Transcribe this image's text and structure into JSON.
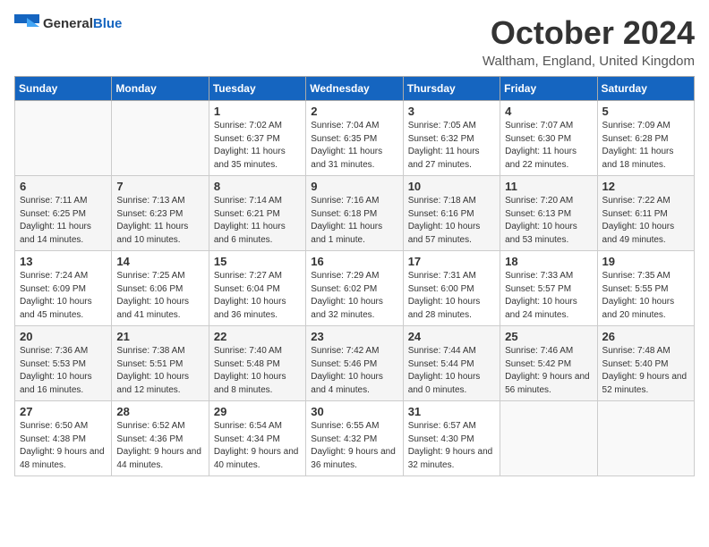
{
  "header": {
    "logo_general": "General",
    "logo_blue": "Blue",
    "month_title": "October 2024",
    "location": "Waltham, England, United Kingdom"
  },
  "weekdays": [
    "Sunday",
    "Monday",
    "Tuesday",
    "Wednesday",
    "Thursday",
    "Friday",
    "Saturday"
  ],
  "weeks": [
    [
      {
        "day": "",
        "sunrise": "",
        "sunset": "",
        "daylight": ""
      },
      {
        "day": "",
        "sunrise": "",
        "sunset": "",
        "daylight": ""
      },
      {
        "day": "1",
        "sunrise": "Sunrise: 7:02 AM",
        "sunset": "Sunset: 6:37 PM",
        "daylight": "Daylight: 11 hours and 35 minutes."
      },
      {
        "day": "2",
        "sunrise": "Sunrise: 7:04 AM",
        "sunset": "Sunset: 6:35 PM",
        "daylight": "Daylight: 11 hours and 31 minutes."
      },
      {
        "day": "3",
        "sunrise": "Sunrise: 7:05 AM",
        "sunset": "Sunset: 6:32 PM",
        "daylight": "Daylight: 11 hours and 27 minutes."
      },
      {
        "day": "4",
        "sunrise": "Sunrise: 7:07 AM",
        "sunset": "Sunset: 6:30 PM",
        "daylight": "Daylight: 11 hours and 22 minutes."
      },
      {
        "day": "5",
        "sunrise": "Sunrise: 7:09 AM",
        "sunset": "Sunset: 6:28 PM",
        "daylight": "Daylight: 11 hours and 18 minutes."
      }
    ],
    [
      {
        "day": "6",
        "sunrise": "Sunrise: 7:11 AM",
        "sunset": "Sunset: 6:25 PM",
        "daylight": "Daylight: 11 hours and 14 minutes."
      },
      {
        "day": "7",
        "sunrise": "Sunrise: 7:13 AM",
        "sunset": "Sunset: 6:23 PM",
        "daylight": "Daylight: 11 hours and 10 minutes."
      },
      {
        "day": "8",
        "sunrise": "Sunrise: 7:14 AM",
        "sunset": "Sunset: 6:21 PM",
        "daylight": "Daylight: 11 hours and 6 minutes."
      },
      {
        "day": "9",
        "sunrise": "Sunrise: 7:16 AM",
        "sunset": "Sunset: 6:18 PM",
        "daylight": "Daylight: 11 hours and 1 minute."
      },
      {
        "day": "10",
        "sunrise": "Sunrise: 7:18 AM",
        "sunset": "Sunset: 6:16 PM",
        "daylight": "Daylight: 10 hours and 57 minutes."
      },
      {
        "day": "11",
        "sunrise": "Sunrise: 7:20 AM",
        "sunset": "Sunset: 6:13 PM",
        "daylight": "Daylight: 10 hours and 53 minutes."
      },
      {
        "day": "12",
        "sunrise": "Sunrise: 7:22 AM",
        "sunset": "Sunset: 6:11 PM",
        "daylight": "Daylight: 10 hours and 49 minutes."
      }
    ],
    [
      {
        "day": "13",
        "sunrise": "Sunrise: 7:24 AM",
        "sunset": "Sunset: 6:09 PM",
        "daylight": "Daylight: 10 hours and 45 minutes."
      },
      {
        "day": "14",
        "sunrise": "Sunrise: 7:25 AM",
        "sunset": "Sunset: 6:06 PM",
        "daylight": "Daylight: 10 hours and 41 minutes."
      },
      {
        "day": "15",
        "sunrise": "Sunrise: 7:27 AM",
        "sunset": "Sunset: 6:04 PM",
        "daylight": "Daylight: 10 hours and 36 minutes."
      },
      {
        "day": "16",
        "sunrise": "Sunrise: 7:29 AM",
        "sunset": "Sunset: 6:02 PM",
        "daylight": "Daylight: 10 hours and 32 minutes."
      },
      {
        "day": "17",
        "sunrise": "Sunrise: 7:31 AM",
        "sunset": "Sunset: 6:00 PM",
        "daylight": "Daylight: 10 hours and 28 minutes."
      },
      {
        "day": "18",
        "sunrise": "Sunrise: 7:33 AM",
        "sunset": "Sunset: 5:57 PM",
        "daylight": "Daylight: 10 hours and 24 minutes."
      },
      {
        "day": "19",
        "sunrise": "Sunrise: 7:35 AM",
        "sunset": "Sunset: 5:55 PM",
        "daylight": "Daylight: 10 hours and 20 minutes."
      }
    ],
    [
      {
        "day": "20",
        "sunrise": "Sunrise: 7:36 AM",
        "sunset": "Sunset: 5:53 PM",
        "daylight": "Daylight: 10 hours and 16 minutes."
      },
      {
        "day": "21",
        "sunrise": "Sunrise: 7:38 AM",
        "sunset": "Sunset: 5:51 PM",
        "daylight": "Daylight: 10 hours and 12 minutes."
      },
      {
        "day": "22",
        "sunrise": "Sunrise: 7:40 AM",
        "sunset": "Sunset: 5:48 PM",
        "daylight": "Daylight: 10 hours and 8 minutes."
      },
      {
        "day": "23",
        "sunrise": "Sunrise: 7:42 AM",
        "sunset": "Sunset: 5:46 PM",
        "daylight": "Daylight: 10 hours and 4 minutes."
      },
      {
        "day": "24",
        "sunrise": "Sunrise: 7:44 AM",
        "sunset": "Sunset: 5:44 PM",
        "daylight": "Daylight: 10 hours and 0 minutes."
      },
      {
        "day": "25",
        "sunrise": "Sunrise: 7:46 AM",
        "sunset": "Sunset: 5:42 PM",
        "daylight": "Daylight: 9 hours and 56 minutes."
      },
      {
        "day": "26",
        "sunrise": "Sunrise: 7:48 AM",
        "sunset": "Sunset: 5:40 PM",
        "daylight": "Daylight: 9 hours and 52 minutes."
      }
    ],
    [
      {
        "day": "27",
        "sunrise": "Sunrise: 6:50 AM",
        "sunset": "Sunset: 4:38 PM",
        "daylight": "Daylight: 9 hours and 48 minutes."
      },
      {
        "day": "28",
        "sunrise": "Sunrise: 6:52 AM",
        "sunset": "Sunset: 4:36 PM",
        "daylight": "Daylight: 9 hours and 44 minutes."
      },
      {
        "day": "29",
        "sunrise": "Sunrise: 6:54 AM",
        "sunset": "Sunset: 4:34 PM",
        "daylight": "Daylight: 9 hours and 40 minutes."
      },
      {
        "day": "30",
        "sunrise": "Sunrise: 6:55 AM",
        "sunset": "Sunset: 4:32 PM",
        "daylight": "Daylight: 9 hours and 36 minutes."
      },
      {
        "day": "31",
        "sunrise": "Sunrise: 6:57 AM",
        "sunset": "Sunset: 4:30 PM",
        "daylight": "Daylight: 9 hours and 32 minutes."
      },
      {
        "day": "",
        "sunrise": "",
        "sunset": "",
        "daylight": ""
      },
      {
        "day": "",
        "sunrise": "",
        "sunset": "",
        "daylight": ""
      }
    ]
  ]
}
